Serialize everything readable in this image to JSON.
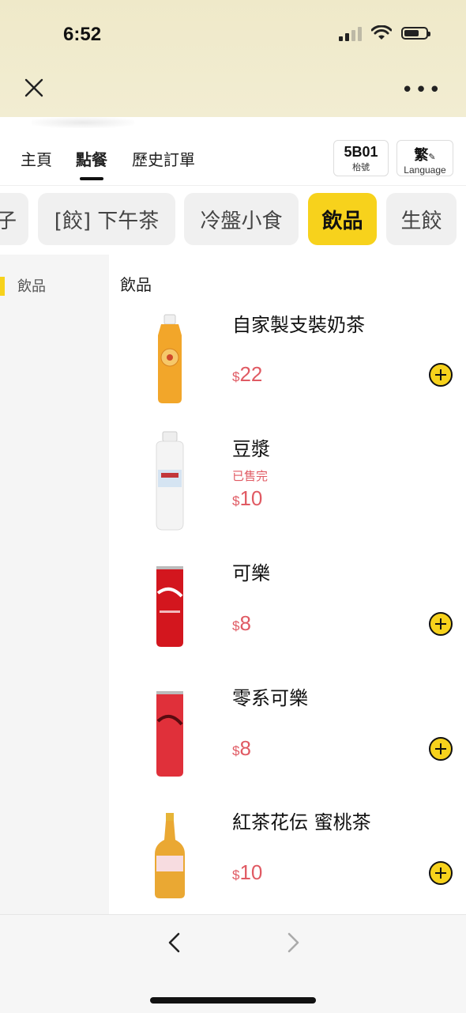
{
  "status": {
    "time": "6:52"
  },
  "nav": {
    "tabs": [
      "主頁",
      "點餐",
      "歷史訂單"
    ],
    "active_tab": "點餐",
    "table_code": "5B01",
    "table_label": "枱號",
    "lang_current": "繁",
    "lang_label": "Language"
  },
  "categories": {
    "items": [
      "子",
      "[餃] 下午茶",
      "冷盤小食",
      "飲品",
      "生餃"
    ],
    "active": "飲品"
  },
  "sidebar": {
    "label": "飲品"
  },
  "section": {
    "title": "飲品"
  },
  "products": [
    {
      "name": "自家製支裝奶茶",
      "currency": "$",
      "price": "22",
      "sold_out": ""
    },
    {
      "name": "豆漿",
      "currency": "$",
      "price": "10",
      "sold_out": "已售完"
    },
    {
      "name": "可樂",
      "currency": "$",
      "price": "8",
      "sold_out": ""
    },
    {
      "name": "零系可樂",
      "currency": "$",
      "price": "8",
      "sold_out": ""
    },
    {
      "name": "紅茶花伝 蜜桃茶",
      "currency": "$",
      "price": "10",
      "sold_out": ""
    }
  ],
  "colors": {
    "accent": "#f7d21c",
    "price": "#e05a63"
  }
}
